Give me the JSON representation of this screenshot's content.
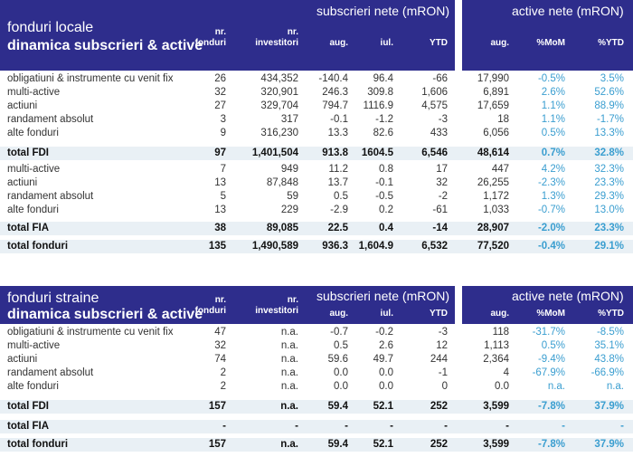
{
  "colors": {
    "header_bg": "#2e2d8c",
    "shade": "#e9f0f5",
    "pct_blue": "#3a9ed0"
  },
  "local": {
    "title1": "fonduri locale",
    "title2": "dinamica subscrieri & active",
    "group_subs": "subscrieri nete (mRON)",
    "group_active": "active nete (mRON)",
    "col_nr_fonduri": [
      "nr.",
      "fonduri"
    ],
    "col_nr_investitori": [
      "nr.",
      "investitori"
    ],
    "col_aug": "aug.",
    "col_iul": "iul.",
    "col_ytd": "YTD",
    "col_aug2": "aug.",
    "col_mom": "%MoM",
    "col_pytd": "%YTD",
    "rows": [
      {
        "label": "obligatiuni & instrumente cu venit fix",
        "nf": "26",
        "ni": "434,352",
        "aug": "-140.4",
        "iul": "96.4",
        "ytd": "-66",
        "act": "17,990",
        "mom": "-0.5%",
        "pytd": "3.5%"
      },
      {
        "label": "multi-active",
        "nf": "32",
        "ni": "320,901",
        "aug": "246.3",
        "iul": "309.8",
        "ytd": "1,606",
        "act": "6,891",
        "mom": "2.6%",
        "pytd": "52.6%"
      },
      {
        "label": "actiuni",
        "nf": "27",
        "ni": "329,704",
        "aug": "794.7",
        "iul": "1116.9",
        "ytd": "4,575",
        "act": "17,659",
        "mom": "1.1%",
        "pytd": "88.9%"
      },
      {
        "label": "randament absolut",
        "nf": "3",
        "ni": "317",
        "aug": "-0.1",
        "iul": "-1.2",
        "ytd": "-3",
        "act": "18",
        "mom": "1.1%",
        "pytd": "-1.7%"
      },
      {
        "label": "alte fonduri",
        "nf": "9",
        "ni": "316,230",
        "aug": "13.3",
        "iul": "82.6",
        "ytd": "433",
        "act": "6,056",
        "mom": "0.5%",
        "pytd": "13.3%"
      },
      {
        "label": "total FDI",
        "nf": "97",
        "ni": "1,401,504",
        "aug": "913.8",
        "iul": "1604.5",
        "ytd": "6,546",
        "act": "48,614",
        "mom": "0.7%",
        "pytd": "32.8%",
        "total": true
      },
      {
        "label": "multi-active",
        "nf": "7",
        "ni": "949",
        "aug": "11.2",
        "iul": "0.8",
        "ytd": "17",
        "act": "447",
        "mom": "4.2%",
        "pytd": "32.3%"
      },
      {
        "label": "actiuni",
        "nf": "13",
        "ni": "87,848",
        "aug": "13.7",
        "iul": "-0.1",
        "ytd": "32",
        "act": "26,255",
        "mom": "-2.3%",
        "pytd": "23.3%"
      },
      {
        "label": "randament absolut",
        "nf": "5",
        "ni": "59",
        "aug": "0.5",
        "iul": "-0.5",
        "ytd": "-2",
        "act": "1,172",
        "mom": "1.3%",
        "pytd": "29.3%"
      },
      {
        "label": "alte fonduri",
        "nf": "13",
        "ni": "229",
        "aug": "-2.9",
        "iul": "0.2",
        "ytd": "-61",
        "act": "1,033",
        "mom": "-0.7%",
        "pytd": "13.0%"
      },
      {
        "label": "total FIA",
        "nf": "38",
        "ni": "89,085",
        "aug": "22.5",
        "iul": "0.4",
        "ytd": "-14",
        "act": "28,907",
        "mom": "-2.0%",
        "pytd": "23.3%",
        "total": true
      },
      {
        "label": "total fonduri",
        "nf": "135",
        "ni": "1,490,589",
        "aug": "936.3",
        "iul": "1,604.9",
        "ytd": "6,532",
        "act": "77,520",
        "mom": "-0.4%",
        "pytd": "29.1%",
        "total": true
      }
    ]
  },
  "straine": {
    "title1": "fonduri straine",
    "title2": "dinamica subscrieri & active",
    "group_subs": "subscrieri nete (mRON)",
    "group_active": "active nete (mRON)",
    "col_nr_fonduri": [
      "nr.",
      "fonduri"
    ],
    "col_nr_investitori": [
      "nr.",
      "investitori"
    ],
    "col_aug": "aug.",
    "col_iul": "iul.",
    "col_ytd": "YTD",
    "col_aug2": "aug.",
    "col_mom": "%MoM",
    "col_pytd": "%YTD",
    "rows": [
      {
        "label": "obligatiuni & instrumente cu venit fix",
        "nf": "47",
        "ni": "n.a.",
        "aug": "-0.7",
        "iul": "-0.2",
        "ytd": "-3",
        "act": "118",
        "mom": "-31.7%",
        "pytd": "-8.5%"
      },
      {
        "label": "multi-active",
        "nf": "32",
        "ni": "n.a.",
        "aug": "0.5",
        "iul": "2.6",
        "ytd": "12",
        "act": "1,113",
        "mom": "0.5%",
        "pytd": "35.1%"
      },
      {
        "label": "actiuni",
        "nf": "74",
        "ni": "n.a.",
        "aug": "59.6",
        "iul": "49.7",
        "ytd": "244",
        "act": "2,364",
        "mom": "-9.4%",
        "pytd": "43.8%"
      },
      {
        "label": "randament absolut",
        "nf": "2",
        "ni": "n.a.",
        "aug": "0.0",
        "iul": "0.0",
        "ytd": "-1",
        "act": "4",
        "mom": "-67.9%",
        "pytd": "-66.9%"
      },
      {
        "label": "alte fonduri",
        "nf": "2",
        "ni": "n.a.",
        "aug": "0.0",
        "iul": "0.0",
        "ytd": "0",
        "act": "0.0",
        "mom": "n.a.",
        "pytd": "n.a."
      },
      {
        "label": "total FDI",
        "nf": "157",
        "ni": "n.a.",
        "aug": "59.4",
        "iul": "52.1",
        "ytd": "252",
        "act": "3,599",
        "mom": "-7.8%",
        "pytd": "37.9%",
        "total": true
      },
      {
        "label": "total FIA",
        "nf": "-",
        "ni": "-",
        "aug": "-",
        "iul": "-",
        "ytd": "-",
        "act": "-",
        "mom": "-",
        "pytd": "-",
        "total": true
      },
      {
        "label": "total fonduri",
        "nf": "157",
        "ni": "n.a.",
        "aug": "59.4",
        "iul": "52.1",
        "ytd": "252",
        "act": "3,599",
        "mom": "-7.8%",
        "pytd": "37.9%",
        "total": true
      }
    ]
  }
}
